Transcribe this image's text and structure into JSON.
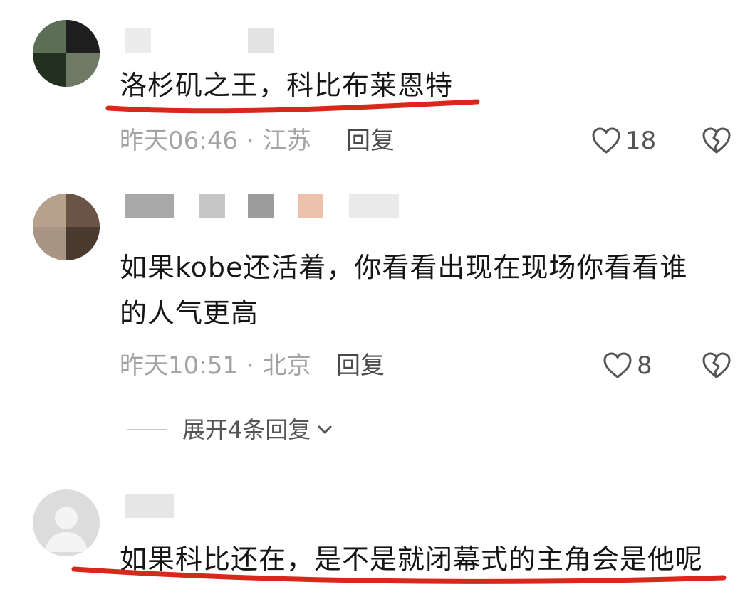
{
  "comments": [
    {
      "text": "洛杉矶之王，科比布莱恩特",
      "time": "昨天06:46",
      "location": "江苏",
      "reply_label": "回复",
      "likes": "18"
    },
    {
      "text_line1": "如果kobe还活着，你看看出现在现场你看看谁",
      "text_line2": "的人气更高",
      "time": "昨天10:51",
      "location": "北京",
      "reply_label": "回复",
      "likes": "8"
    },
    {
      "text": "如果科比还在，是不是就闭幕式的主角会是他呢"
    }
  ],
  "expand_replies": {
    "label": "展开4条回复"
  },
  "meta_separator": "·",
  "icons": {
    "like": "heart-outline-icon",
    "dislike": "broken-heart-icon",
    "expand": "chevron-down-icon"
  },
  "colors": {
    "highlight_underline": "#d8281c",
    "meta_text": "#a3a3a3",
    "body_text": "#151515"
  }
}
